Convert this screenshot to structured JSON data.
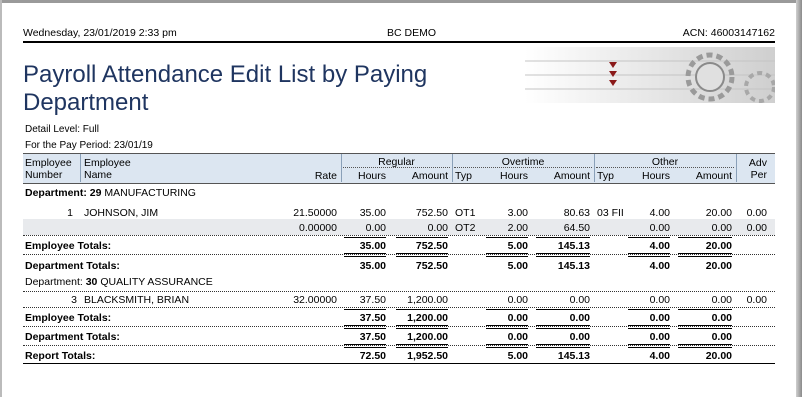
{
  "header": {
    "date": "Wednesday, 23/01/2019  2:33 pm",
    "company": "BC DEMO",
    "acn": "ACN: 46003147162"
  },
  "title": "Payroll Attendance Edit List by Paying Department",
  "meta": {
    "detail_level": "Detail Level:  Full",
    "pay_period": "For the Pay Period:  23/01/19"
  },
  "columns": {
    "emp_number": [
      "Employee",
      "Number"
    ],
    "emp_name": [
      "Employee",
      "Name"
    ],
    "rate": "Rate",
    "regular": "Regular",
    "overtime": "Overtime",
    "other": "Other",
    "adv": [
      "Adv",
      "Per"
    ],
    "hours": "Hours",
    "amount": "Amount",
    "typ": "Typ"
  },
  "departments": [
    {
      "label": "Department:",
      "number": "29",
      "name": "MANUFACTURING",
      "employee": {
        "number": "1",
        "name": "JOHNSON, JIM",
        "rows": [
          {
            "rate": "21.50000",
            "reg_hours": "35.00",
            "reg_amount": "752.50",
            "ot_typ": "OT1",
            "ot_hours": "3.00",
            "ot_amount": "80.63",
            "oth_typ": "03 FII",
            "oth_hours": "4.00",
            "oth_amount": "20.00",
            "adv": "0.00"
          },
          {
            "rate": "0.00000",
            "reg_hours": "0.00",
            "reg_amount": "0.00",
            "ot_typ": "OT2",
            "ot_hours": "2.00",
            "ot_amount": "64.50",
            "oth_typ": "",
            "oth_hours": "0.00",
            "oth_amount": "0.00",
            "adv": "0.00"
          }
        ]
      },
      "employee_totals": {
        "label": "Employee Totals:",
        "reg_hours": "35.00",
        "reg_amount": "752.50",
        "ot_hours": "5.00",
        "ot_amount": "145.13",
        "oth_hours": "4.00",
        "oth_amount": "20.00"
      },
      "department_totals": {
        "label": "Department Totals:",
        "reg_hours": "35.00",
        "reg_amount": "752.50",
        "ot_hours": "5.00",
        "ot_amount": "145.13",
        "oth_hours": "4.00",
        "oth_amount": "20.00"
      }
    },
    {
      "label": "Department:",
      "number": "30",
      "name": "QUALITY ASSURANCE",
      "employee": {
        "number": "3",
        "name": "BLACKSMITH, BRIAN",
        "rows": [
          {
            "rate": "32.00000",
            "reg_hours": "37.50",
            "reg_amount": "1,200.00",
            "ot_typ": "",
            "ot_hours": "0.00",
            "ot_amount": "0.00",
            "oth_typ": "",
            "oth_hours": "0.00",
            "oth_amount": "0.00",
            "adv": "0.00"
          }
        ]
      },
      "employee_totals": {
        "label": "Employee Totals:",
        "reg_hours": "37.50",
        "reg_amount": "1,200.00",
        "ot_hours": "0.00",
        "ot_amount": "0.00",
        "oth_hours": "0.00",
        "oth_amount": "0.00"
      },
      "department_totals": {
        "label": "Department Totals:",
        "reg_hours": "37.50",
        "reg_amount": "1,200.00",
        "ot_hours": "0.00",
        "ot_amount": "0.00",
        "oth_hours": "0.00",
        "oth_amount": "0.00"
      }
    }
  ],
  "report_totals": {
    "label": "Report Totals:",
    "reg_hours": "72.50",
    "reg_amount": "1,952.50",
    "ot_hours": "5.00",
    "ot_amount": "145.13",
    "oth_hours": "4.00",
    "oth_amount": "20.00"
  }
}
